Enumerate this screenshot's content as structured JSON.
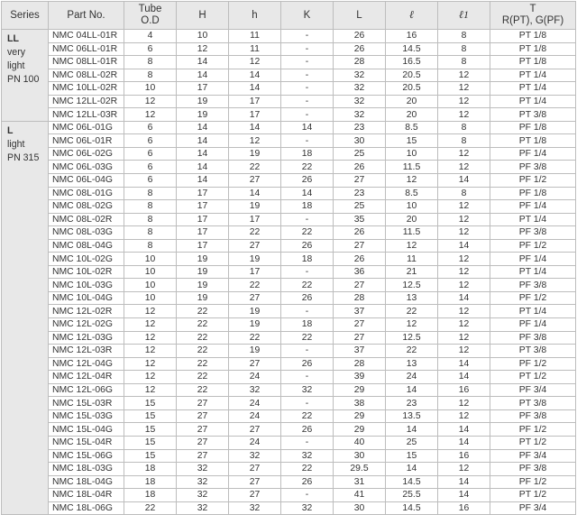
{
  "headers": {
    "series": "Series",
    "part_no": "Part No.",
    "tube_od": [
      "Tube",
      "O.D"
    ],
    "H": "H",
    "h": "h",
    "K": "K",
    "L": "L",
    "l": "ℓ",
    "l1": "ℓ1",
    "T": [
      "T",
      "R(PT), G(PF)"
    ]
  },
  "groups": [
    {
      "series": [
        "LL",
        "very",
        "light",
        "PN 100"
      ],
      "rows": [
        [
          "NMC 04LL-01R",
          "4",
          "10",
          "11",
          "-",
          "26",
          "16",
          "8",
          "PT 1/8"
        ],
        [
          "NMC 06LL-01R",
          "6",
          "12",
          "11",
          "-",
          "26",
          "14.5",
          "8",
          "PT 1/8"
        ],
        [
          "NMC 08LL-01R",
          "8",
          "14",
          "12",
          "-",
          "28",
          "16.5",
          "8",
          "PT 1/8"
        ],
        [
          "NMC 08LL-02R",
          "8",
          "14",
          "14",
          "-",
          "32",
          "20.5",
          "12",
          "PT 1/4"
        ],
        [
          "NMC 10LL-02R",
          "10",
          "17",
          "14",
          "-",
          "32",
          "20.5",
          "12",
          "PT 1/4"
        ],
        [
          "NMC 12LL-02R",
          "12",
          "19",
          "17",
          "-",
          "32",
          "20",
          "12",
          "PT 1/4"
        ],
        [
          "NMC 12LL-03R",
          "12",
          "19",
          "17",
          "-",
          "32",
          "20",
          "12",
          "PT 3/8"
        ]
      ]
    },
    {
      "series": [
        "L",
        "light",
        "PN 315"
      ],
      "rows": [
        [
          "NMC 06L-01G",
          "6",
          "14",
          "14",
          "14",
          "23",
          "8.5",
          "8",
          "PF 1/8"
        ],
        [
          "NMC 06L-01R",
          "6",
          "14",
          "12",
          "-",
          "30",
          "15",
          "8",
          "PT 1/8"
        ],
        [
          "NMC 06L-02G",
          "6",
          "14",
          "19",
          "18",
          "25",
          "10",
          "12",
          "PF 1/4"
        ],
        [
          "NMC 06L-03G",
          "6",
          "14",
          "22",
          "22",
          "26",
          "11.5",
          "12",
          "PF 3/8"
        ],
        [
          "NMC 06L-04G",
          "6",
          "14",
          "27",
          "26",
          "27",
          "12",
          "14",
          "PF 1/2"
        ],
        [
          "NMC 08L-01G",
          "8",
          "17",
          "14",
          "14",
          "23",
          "8.5",
          "8",
          "PF 1/8"
        ],
        [
          "NMC 08L-02G",
          "8",
          "17",
          "19",
          "18",
          "25",
          "10",
          "12",
          "PF 1/4"
        ],
        [
          "NMC 08L-02R",
          "8",
          "17",
          "17",
          "-",
          "35",
          "20",
          "12",
          "PT 1/4"
        ],
        [
          "NMC 08L-03G",
          "8",
          "17",
          "22",
          "22",
          "26",
          "11.5",
          "12",
          "PF 3/8"
        ],
        [
          "NMC 08L-04G",
          "8",
          "17",
          "27",
          "26",
          "27",
          "12",
          "14",
          "PF 1/2"
        ],
        [
          "NMC 10L-02G",
          "10",
          "19",
          "19",
          "18",
          "26",
          "11",
          "12",
          "PF 1/4"
        ],
        [
          "NMC 10L-02R",
          "10",
          "19",
          "17",
          "-",
          "36",
          "21",
          "12",
          "PT 1/4"
        ],
        [
          "NMC 10L-03G",
          "10",
          "19",
          "22",
          "22",
          "27",
          "12.5",
          "12",
          "PF 3/8"
        ],
        [
          "NMC 10L-04G",
          "10",
          "19",
          "27",
          "26",
          "28",
          "13",
          "14",
          "PF 1/2"
        ],
        [
          "NMC 12L-02R",
          "12",
          "22",
          "19",
          "-",
          "37",
          "22",
          "12",
          "PT 1/4"
        ],
        [
          "NMC 12L-02G",
          "12",
          "22",
          "19",
          "18",
          "27",
          "12",
          "12",
          "PF 1/4"
        ],
        [
          "NMC 12L-03G",
          "12",
          "22",
          "22",
          "22",
          "27",
          "12.5",
          "12",
          "PF 3/8"
        ],
        [
          "NMC 12L-03R",
          "12",
          "22",
          "19",
          "-",
          "37",
          "22",
          "12",
          "PT 3/8"
        ],
        [
          "NMC 12L-04G",
          "12",
          "22",
          "27",
          "26",
          "28",
          "13",
          "14",
          "PF 1/2"
        ],
        [
          "NMC 12L-04R",
          "12",
          "22",
          "24",
          "-",
          "39",
          "24",
          "14",
          "PT 1/2"
        ],
        [
          "NMC 12L-06G",
          "12",
          "22",
          "32",
          "32",
          "29",
          "14",
          "16",
          "PF 3/4"
        ],
        [
          "NMC 15L-03R",
          "15",
          "27",
          "24",
          "-",
          "38",
          "23",
          "12",
          "PT 3/8"
        ],
        [
          "NMC 15L-03G",
          "15",
          "27",
          "24",
          "22",
          "29",
          "13.5",
          "12",
          "PF 3/8"
        ],
        [
          "NMC 15L-04G",
          "15",
          "27",
          "27",
          "26",
          "29",
          "14",
          "14",
          "PF 1/2"
        ],
        [
          "NMC 15L-04R",
          "15",
          "27",
          "24",
          "-",
          "40",
          "25",
          "14",
          "PT 1/2"
        ],
        [
          "NMC 15L-06G",
          "15",
          "27",
          "32",
          "32",
          "30",
          "15",
          "16",
          "PF 3/4"
        ],
        [
          "NMC 18L-03G",
          "18",
          "32",
          "27",
          "22",
          "29.5",
          "14",
          "12",
          "PF 3/8"
        ],
        [
          "NMC 18L-04G",
          "18",
          "32",
          "27",
          "26",
          "31",
          "14.5",
          "14",
          "PF 1/2"
        ],
        [
          "NMC 18L-04R",
          "18",
          "32",
          "27",
          "-",
          "41",
          "25.5",
          "14",
          "PT 1/2"
        ],
        [
          "NMC 18L-06G",
          "22",
          "32",
          "32",
          "32",
          "30",
          "14.5",
          "16",
          "PF 3/4"
        ]
      ]
    }
  ]
}
